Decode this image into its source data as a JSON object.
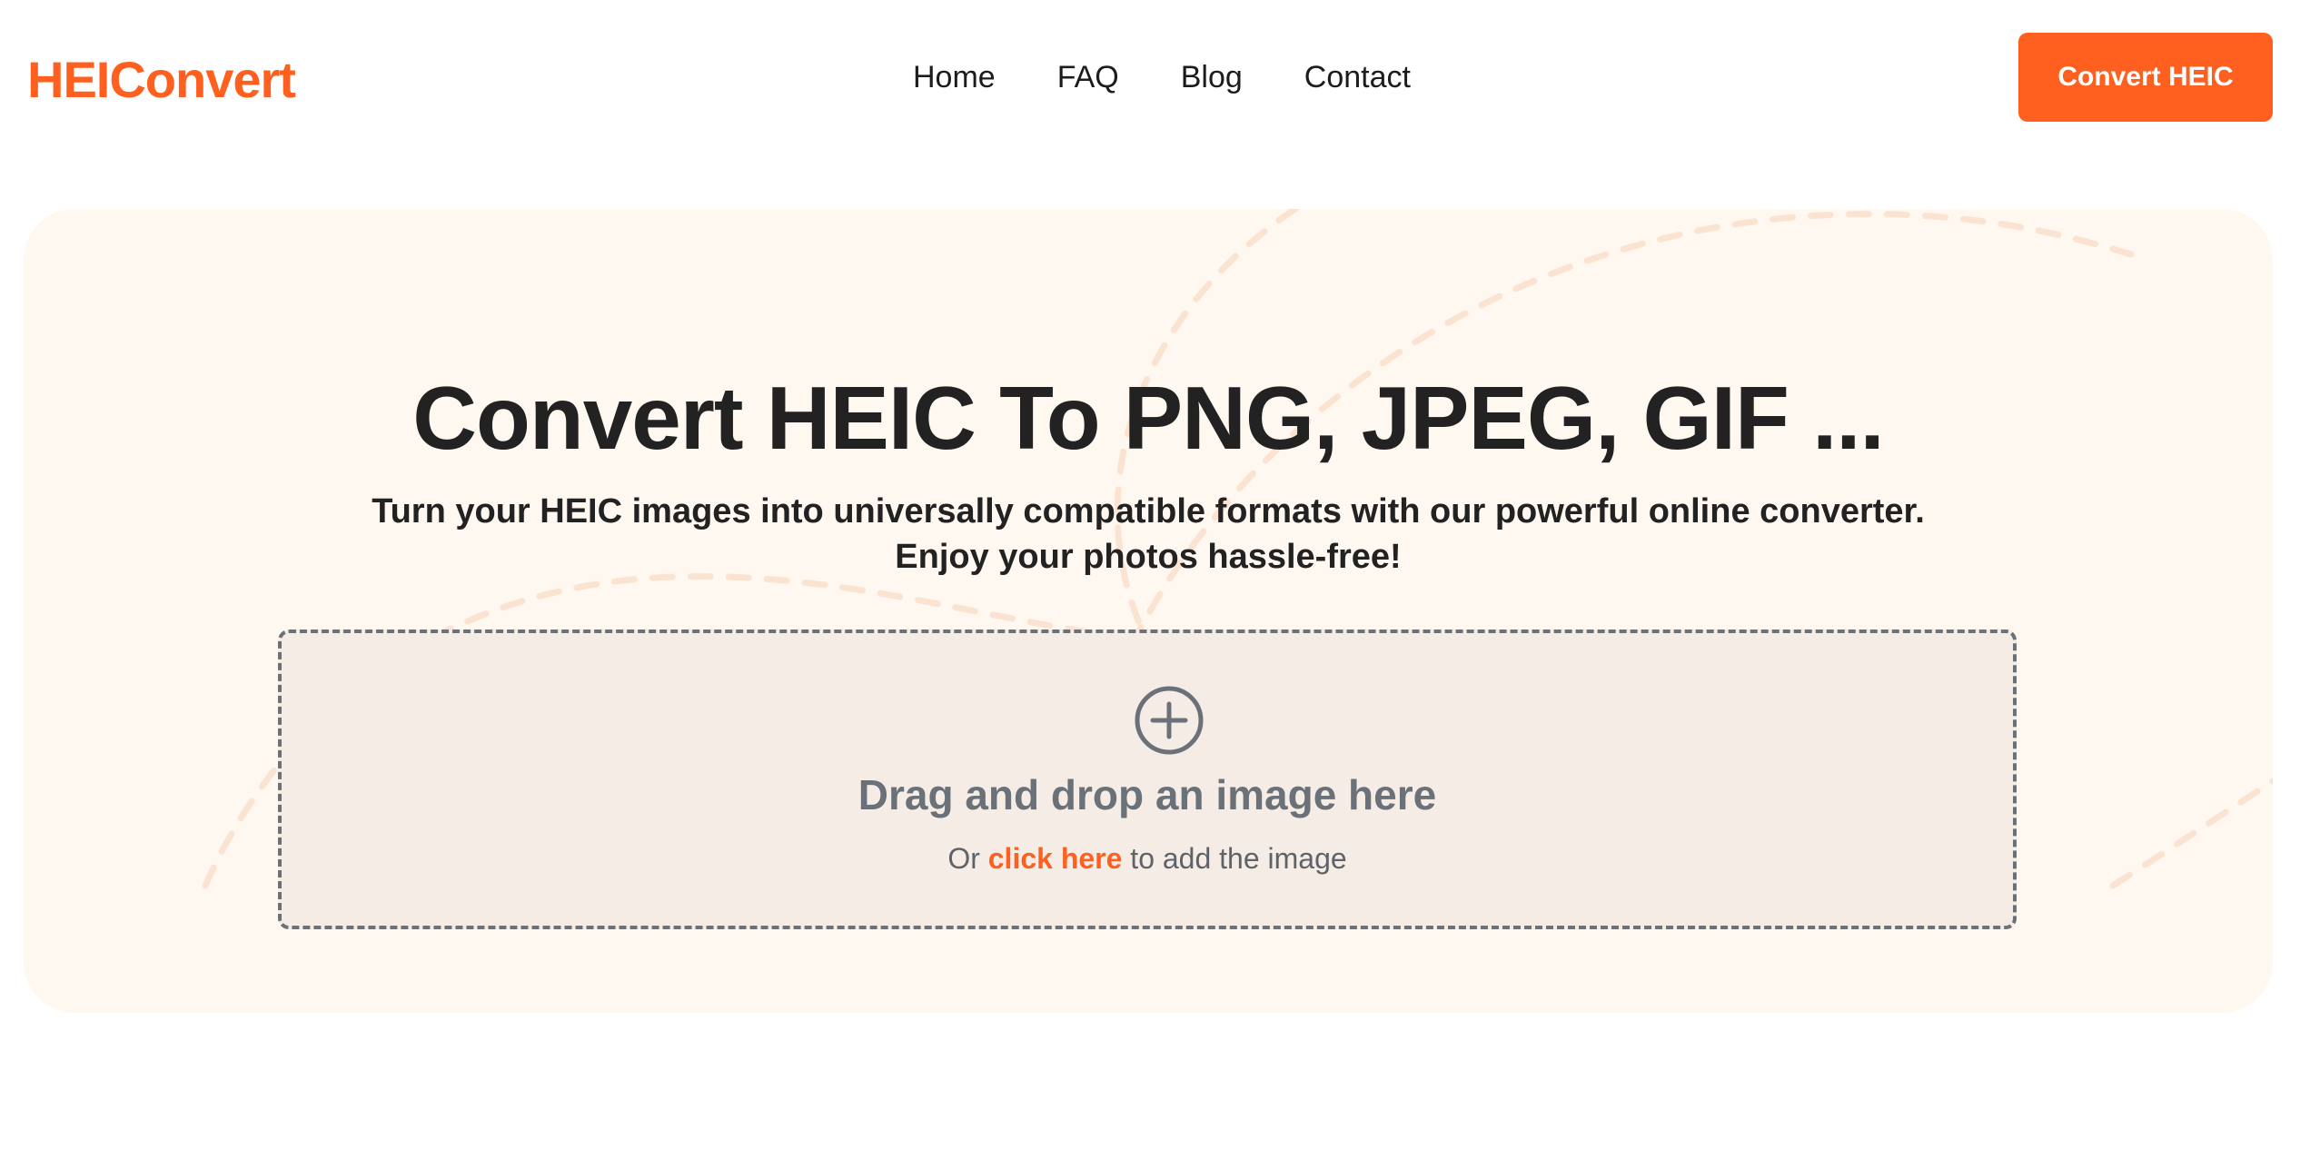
{
  "brand": {
    "name": "HEIConvert",
    "color": "#ff5f1f"
  },
  "nav": {
    "items": [
      {
        "label": "Home"
      },
      {
        "label": "FAQ"
      },
      {
        "label": "Blog"
      },
      {
        "label": "Contact"
      }
    ],
    "cta_label": "Convert HEIC"
  },
  "hero": {
    "title": "Convert HEIC To PNG, JPEG, GIF ...",
    "subtitle_line1": "Turn your HEIC images into universally compatible formats with our powerful online converter.",
    "subtitle_line2": "Enjoy your photos hassle-free!",
    "background_color": "#fff8f1"
  },
  "dropzone": {
    "icon": "plus-circle-icon",
    "title": "Drag and drop an image here",
    "prefix": "Or",
    "link_text": "click here",
    "suffix": "to add the image"
  }
}
